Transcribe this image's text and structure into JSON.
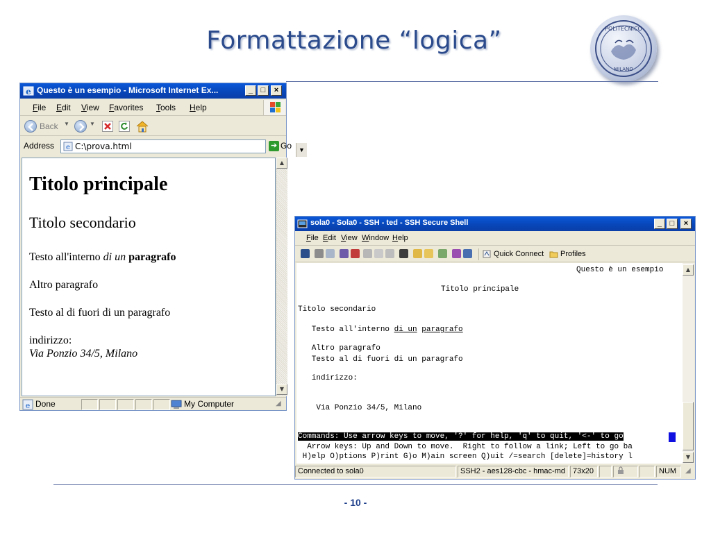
{
  "slide": {
    "title": "Formattazione “logica”",
    "page_number": "- 10 -",
    "logo_lettering": [
      "POLITECNICO",
      "MILANO"
    ]
  },
  "ie": {
    "title": "Questo è un esempio - Microsoft Internet Ex...",
    "menu": [
      "File",
      "Edit",
      "View",
      "Favorites",
      "Tools",
      "Help"
    ],
    "back_label": "Back",
    "address_label": "Address",
    "address_value": "C:\\prova.html",
    "go_label": "Go",
    "content": {
      "h1": "Titolo principale",
      "h2": "Titolo secondario",
      "p1_pre": "Testo all'interno ",
      "p1_em": "di un",
      "p1_mid": " ",
      "p1_strong": "paragrafo",
      "p2": "Altro paragrafo",
      "p3": "Testo al di fuori di un paragrafo",
      "p4_label": "indirizzo:",
      "p4_address": "Via Ponzio 34/5, Milano"
    },
    "status_text": "Done",
    "status_zone": "My Computer"
  },
  "ssh": {
    "title": "sola0 - Sola0 - SSH - ted - SSH Secure Shell",
    "menu": [
      "File",
      "Edit",
      "View",
      "Window",
      "Help"
    ],
    "quick_connect": "Quick Connect",
    "profiles": "Profiles",
    "terminal": {
      "l1": "Questo è un esempio",
      "l2": "Titolo principale",
      "l3": "Titolo secondario",
      "l4_pre": "   Testo all'interno ",
      "l4_u1": "di un",
      "l4_mid": " ",
      "l4_u2": "paragrafo",
      "l5": "   Altro paragrafo",
      "l6": "   Testo al di fuori di un paragrafo",
      "l7": "   indirizzo:",
      "l8": "    Via Ponzio 34/5, Milano",
      "cmd": "Commands: Use arrow keys to move, '?' for help, 'q' to quit, '<-' to go",
      "help1": "  Arrow keys: Up and Down to move.  Right to follow a link; Left to go ba",
      "help2": " H)elp O)ptions P)rint G)o M)ain screen Q)uit /=search [delete]=history l"
    },
    "status": {
      "connected": "Connected to sola0",
      "cipher": "SSH2 - aes128-cbc - hmac-md",
      "size": "73x20",
      "num": "NUM"
    }
  }
}
